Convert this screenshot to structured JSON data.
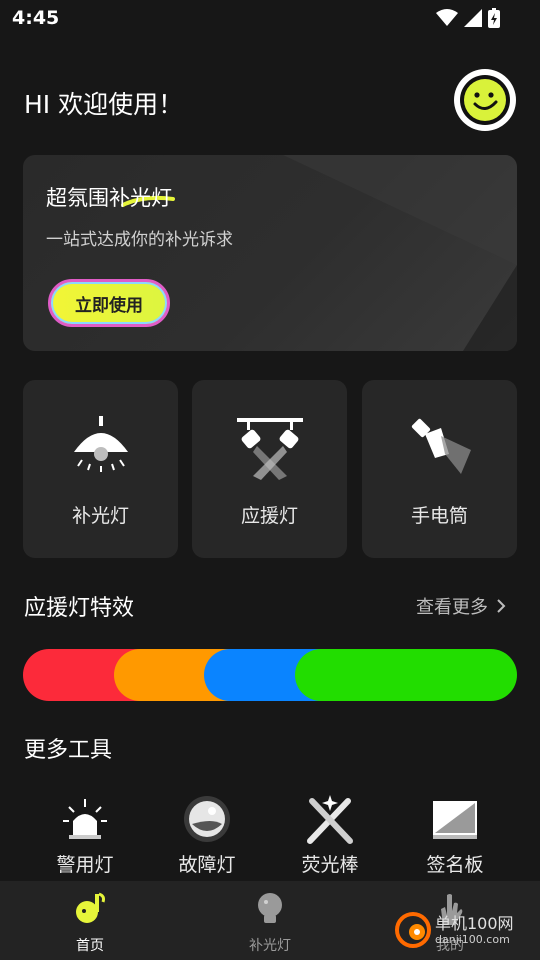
{
  "status_bar": {
    "time": "4:45",
    "icons": [
      "wifi-icon",
      "signal-icon",
      "battery-charging-icon"
    ]
  },
  "header": {
    "greeting": "HI 欢迎使用！",
    "avatar_icon": "smiley-face-icon"
  },
  "banner": {
    "title": "超氛围补光灯",
    "subtitle": "一站式达成你的补光诉求",
    "button_label": "立即使用"
  },
  "features": [
    {
      "label": "补光灯",
      "icon": "ceiling-lamp-icon"
    },
    {
      "label": "应援灯",
      "icon": "stage-spotlight-icon"
    },
    {
      "label": "手电筒",
      "icon": "flashlight-icon"
    }
  ],
  "effects": {
    "title": "应援灯特效",
    "see_more": "查看更多",
    "colors": [
      "#fc2a3a",
      "#ff9900",
      "#0a84ff",
      "#22dd00"
    ]
  },
  "tools": {
    "title": "更多工具",
    "items": [
      {
        "label": "警用灯",
        "icon": "police-siren-icon"
      },
      {
        "label": "故障灯",
        "icon": "ball-lamp-icon"
      },
      {
        "label": "荧光棒",
        "icon": "glow-sticks-icon"
      },
      {
        "label": "签名板",
        "icon": "signature-board-icon"
      }
    ]
  },
  "bottom_nav": {
    "items": [
      {
        "label": "首页",
        "icon": "music-note-home-icon",
        "active": true
      },
      {
        "label": "补光灯",
        "icon": "light-bulb-icon",
        "active": false
      },
      {
        "label": "我的",
        "icon": "hand-icon",
        "active": false
      }
    ]
  },
  "watermark": {
    "text": "单机100网",
    "url": "danji100.com"
  },
  "colors": {
    "background": "#171717",
    "card": "#272727",
    "accent": "#e6f53a",
    "nav_bg": "#232323"
  }
}
